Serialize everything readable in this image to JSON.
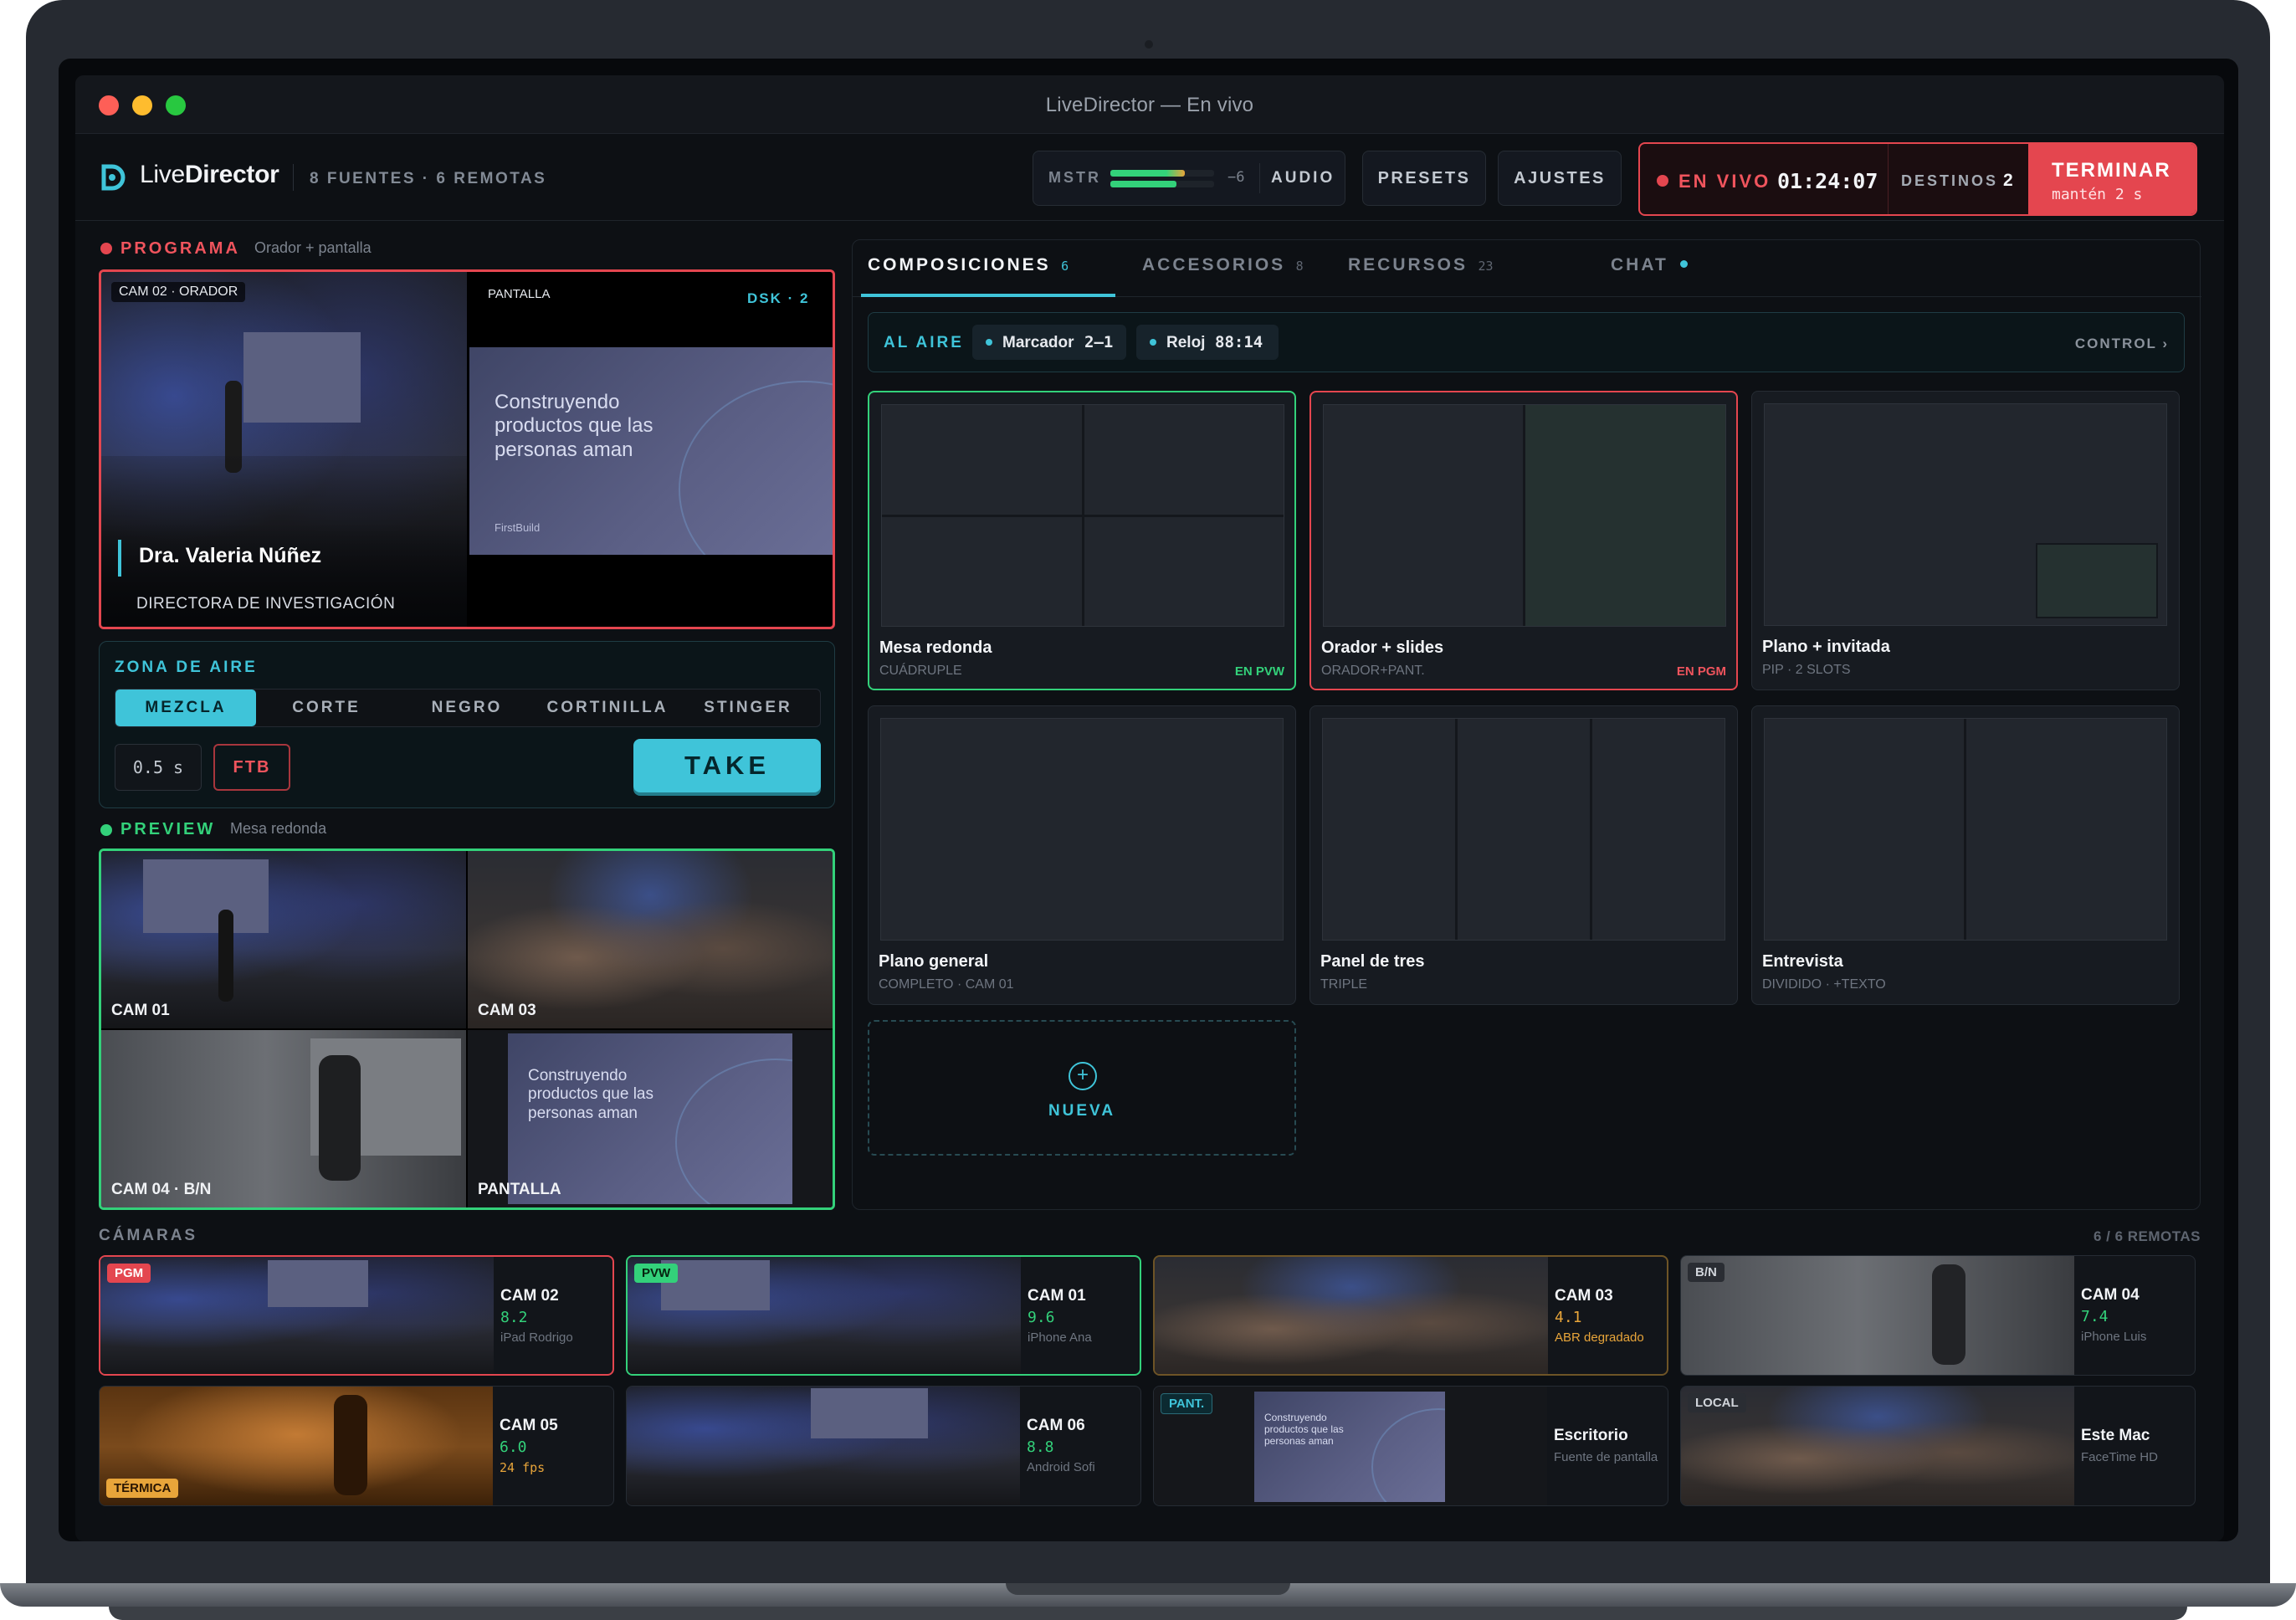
{
  "window": {
    "title": "LiveDirector — En vivo"
  },
  "header": {
    "brand_prefix": "Live",
    "brand_bold": "Director",
    "sources": "8 FUENTES · 6 REMOTAS",
    "master_label": "MSTR",
    "master_level": "−6",
    "audio_label": "AUDIO",
    "presets_label": "PRESETS",
    "settings_label": "AJUSTES",
    "live_label": "EN VIVO",
    "timer": "01:24:07",
    "destinations_label": "DESTINOS",
    "destinations_count": "2",
    "end_label": "TERMINAR",
    "end_hint": "mantén 2 s"
  },
  "program": {
    "label": "PROGRAMA",
    "sub": "Orador + pantalla",
    "cam_tag": "CAM 02 · ORADOR",
    "screen_tag": "PANTALLA",
    "dsk": "DSK · 2",
    "lower_third_name": "Dra. Valeria Núñez",
    "lower_third_role": "DIRECTORA DE INVESTIGACIÓN",
    "slide_text": "Construyendo productos que las personas aman",
    "slide_logo": "FirstBuild"
  },
  "air_zone": {
    "label": "ZONA DE AIRE",
    "transitions": [
      "MEZCLA",
      "CORTE",
      "NEGRO",
      "CORTINILLA",
      "STINGER"
    ],
    "duration": "0.5 s",
    "ftb": "FTB",
    "take": "TAKE"
  },
  "preview": {
    "label": "PREVIEW",
    "sub": "Mesa redonda",
    "cells": [
      "CAM 01",
      "CAM 03",
      "CAM 04 · B/N",
      "PANTALLA"
    ]
  },
  "tabs": [
    {
      "label": "COMPOSICIONES",
      "count": "6"
    },
    {
      "label": "ACCESORIOS",
      "count": "8"
    },
    {
      "label": "RECURSOS",
      "count": "23"
    },
    {
      "label": "CHAT",
      "count": ""
    }
  ],
  "on_air_bar": {
    "label": "AL AIRE",
    "chips": [
      {
        "name": "Marcador",
        "value": "2–1"
      },
      {
        "name": "Reloj",
        "value": "88:14"
      }
    ],
    "control": "CONTROL ›"
  },
  "compositions": [
    {
      "name": "Mesa redonda",
      "sub": "CUÁDRUPLE",
      "badge": "EN PVW"
    },
    {
      "name": "Orador + slides",
      "sub": "ORADOR+PANT.",
      "badge": "EN PGM"
    },
    {
      "name": "Plano + invitada",
      "sub": "PIP · 2 SLOTS",
      "badge": ""
    },
    {
      "name": "Plano general",
      "sub": "COMPLETO · CAM 01",
      "badge": ""
    },
    {
      "name": "Panel de tres",
      "sub": "TRIPLE",
      "badge": ""
    },
    {
      "name": "Entrevista",
      "sub": "DIVIDIDO · +TEXTO",
      "badge": ""
    }
  ],
  "new_composition": "NUEVA",
  "cameras": {
    "label": "CÁMARAS",
    "remote_count": "6 / 6 REMOTAS",
    "items": [
      {
        "tag": "PGM",
        "name": "CAM 02",
        "value": "8.2",
        "device": "iPad Rodrigo"
      },
      {
        "tag": "PVW",
        "name": "CAM 01",
        "value": "9.6",
        "device": "iPhone Ana"
      },
      {
        "tag": "",
        "name": "CAM 03",
        "value": "4.1",
        "device": "ABR degradado"
      },
      {
        "tag": "B/N",
        "name": "CAM 04",
        "value": "7.4",
        "device": "iPhone Luis"
      },
      {
        "tag": "TÉRMICA",
        "name": "CAM 05",
        "value": "6.0",
        "device": "24 fps"
      },
      {
        "tag": "",
        "name": "CAM 06",
        "value": "8.8",
        "device": "Android Sofi"
      },
      {
        "tag": "PANT.",
        "name": "Escritorio",
        "value": "",
        "device": "Fuente de pantalla"
      },
      {
        "tag": "LOCAL",
        "name": "Este Mac",
        "value": "",
        "device": "FaceTime HD"
      }
    ]
  },
  "colors": {
    "accent": "#3fc4d9",
    "program_red": "#e4464f",
    "preview_green": "#33d17a",
    "warning": "#e8a53a"
  },
  "meter": {
    "level_fraction": 0.72
  }
}
